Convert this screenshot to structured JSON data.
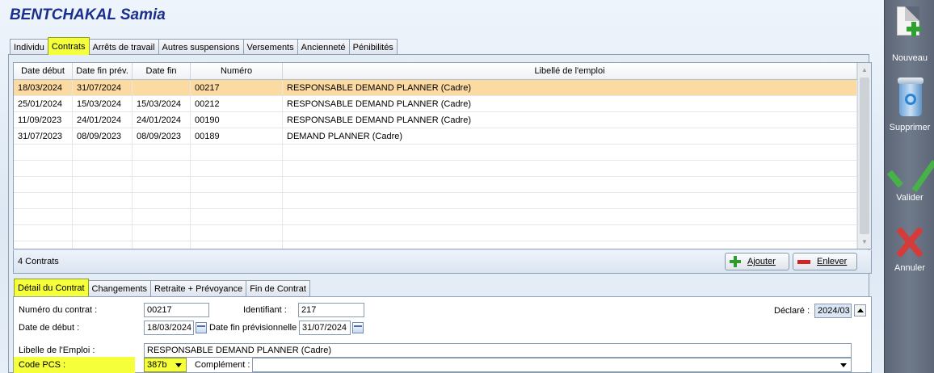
{
  "employee": {
    "name": "BENTCHAKAL Samia"
  },
  "top_tabs": [
    {
      "label": "Individu",
      "active": false
    },
    {
      "label": "Contrats",
      "active": true
    },
    {
      "label": "Arrêts de travail",
      "active": false
    },
    {
      "label": "Autres suspensions",
      "active": false
    },
    {
      "label": "Versements",
      "active": false
    },
    {
      "label": "Ancienneté",
      "active": false
    },
    {
      "label": "Pénibilités",
      "active": false
    }
  ],
  "grid": {
    "columns": [
      "Date début",
      "Date fin prév.",
      "Date fin",
      "Numéro",
      "Libellé de l'emploi"
    ],
    "rows": [
      {
        "date_debut": "18/03/2024",
        "date_fin_prev": "31/07/2024",
        "date_fin": "",
        "numero": "00217",
        "libelle": "RESPONSABLE DEMAND PLANNER (Cadre)",
        "selected": true
      },
      {
        "date_debut": "25/01/2024",
        "date_fin_prev": "15/03/2024",
        "date_fin": "15/03/2024",
        "numero": "00212",
        "libelle": "RESPONSABLE DEMAND PLANNER (Cadre)",
        "selected": false
      },
      {
        "date_debut": "11/09/2023",
        "date_fin_prev": "24/01/2024",
        "date_fin": "24/01/2024",
        "numero": "00190",
        "libelle": "RESPONSABLE DEMAND PLANNER (Cadre)",
        "selected": false
      },
      {
        "date_debut": "31/07/2023",
        "date_fin_prev": "08/09/2023",
        "date_fin": "08/09/2023",
        "numero": "00189",
        "libelle": "DEMAND PLANNER (Cadre)",
        "selected": false
      }
    ],
    "count_label": "4 Contrats",
    "add_label": "Ajouter",
    "remove_label": "Enlever"
  },
  "detail_tabs": [
    {
      "label": "Détail du Contrat",
      "active": true
    },
    {
      "label": "Changements",
      "active": false
    },
    {
      "label": "Retraite + Prévoyance",
      "active": false
    },
    {
      "label": "Fin de Contrat",
      "active": false
    }
  ],
  "detail": {
    "numero_label": "Numéro du contrat :",
    "numero_value": "00217",
    "identifiant_label": "Identifiant :",
    "identifiant_value": "217",
    "declare_label": "Déclaré :",
    "declare_value": "2024/03",
    "date_debut_label": "Date de début :",
    "date_debut_value": "18/03/2024",
    "date_fin_prev_label": "Date fin prévisionnelle :",
    "date_fin_prev_value": "31/07/2024",
    "libelle_label": "Libelle de l'Emploi :",
    "libelle_value": "RESPONSABLE DEMAND PLANNER (Cadre)",
    "pcs_label": "Code PCS :",
    "pcs_value": "387b",
    "complement_label": "Complément :",
    "complement_value": ""
  },
  "toolbar": {
    "nouveau": "Nouveau",
    "supprimer": "Supprimer",
    "valider": "Valider",
    "annuler": "Annuler"
  },
  "colors": {
    "highlight": "#f5ff3a",
    "selected_row": "#fbdba2",
    "title": "#1a2f8c"
  }
}
